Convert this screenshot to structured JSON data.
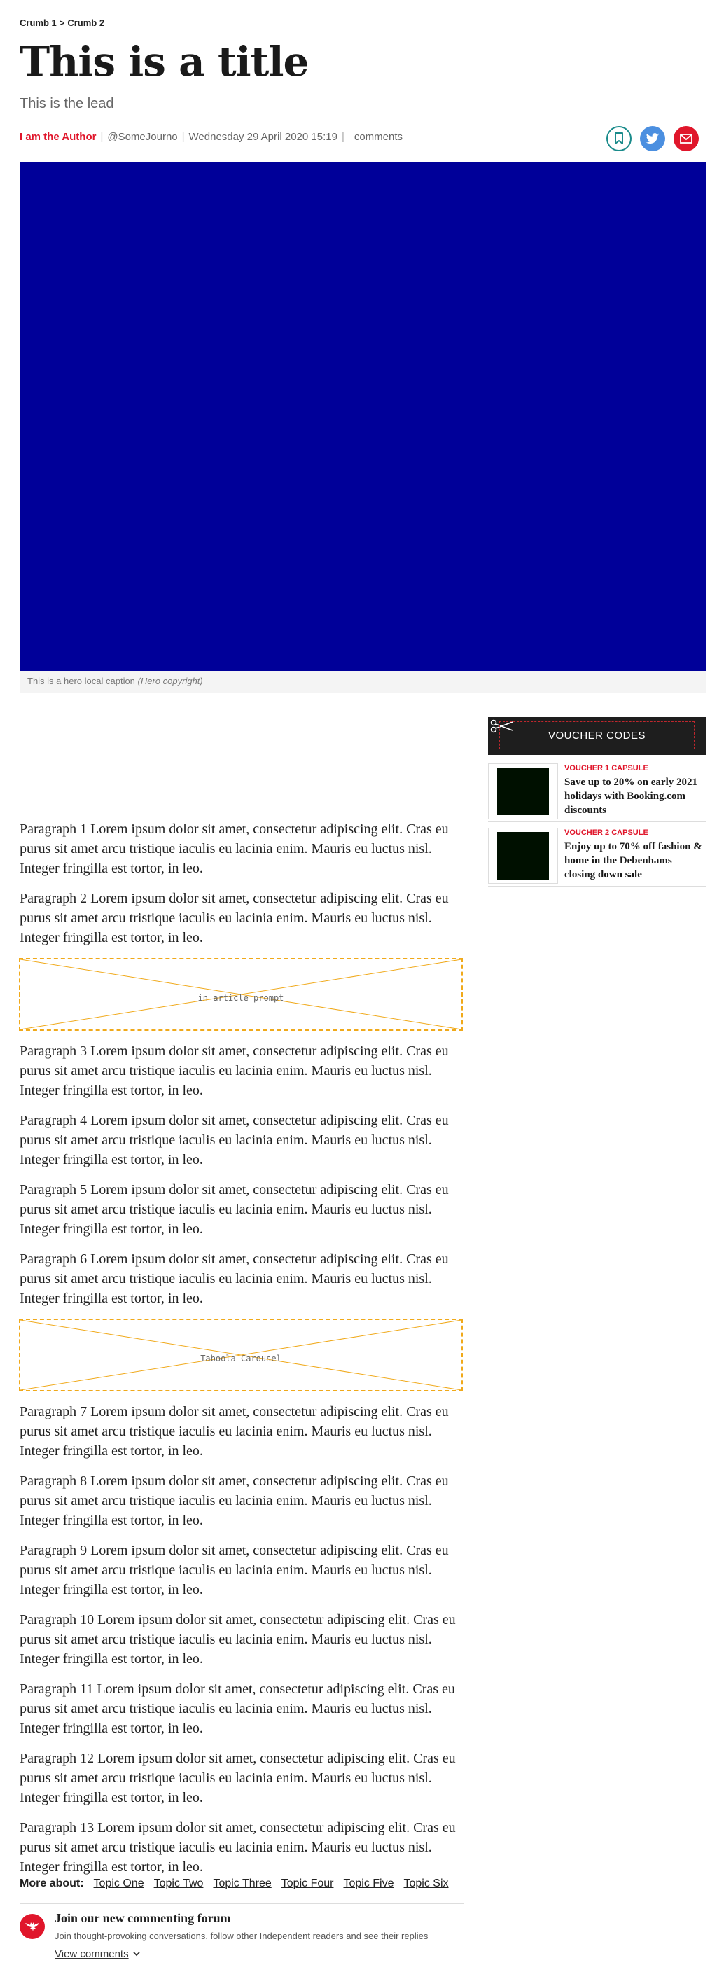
{
  "breadcrumb": {
    "crumb1": "Crumb 1",
    "separator": ">",
    "crumb2": "Crumb 2"
  },
  "title": "This is a title",
  "lead": "This is the lead",
  "byline": {
    "author": "I am the Author",
    "handle": "@SomeJourno",
    "date": "Wednesday 29 April 2020 15:19",
    "comments": "comments"
  },
  "share": {
    "icons": [
      "bookmark-icon",
      "twitter-icon",
      "email-icon"
    ],
    "colors": {
      "bookmark": "#1a8b8b",
      "twitter": "#4b8fe0",
      "email": "#e0162b"
    }
  },
  "hero": {
    "color": "#000099",
    "caption": "This is a hero local caption",
    "copyright": "(Hero copyright)"
  },
  "article": {
    "paragraphs": [
      "Paragraph 1 Lorem ipsum dolor sit amet, consectetur adipiscing elit. Cras eu purus sit amet arcu tristique iaculis eu lacinia enim. Mauris eu luctus nisl. Integer fringilla est tortor, in leo.",
      "Paragraph 2 Lorem ipsum dolor sit amet, consectetur adipiscing elit. Cras eu purus sit amet arcu tristique iaculis eu lacinia enim. Mauris eu luctus nisl. Integer fringilla est tortor, in leo.",
      "Paragraph 3 Lorem ipsum dolor sit amet, consectetur adipiscing elit. Cras eu purus sit amet arcu tristique iaculis eu lacinia enim. Mauris eu luctus nisl. Integer fringilla est tortor, in leo.",
      "Paragraph 4 Lorem ipsum dolor sit amet, consectetur adipiscing elit. Cras eu purus sit amet arcu tristique iaculis eu lacinia enim. Mauris eu luctus nisl. Integer fringilla est tortor, in leo.",
      "Paragraph 5 Lorem ipsum dolor sit amet, consectetur adipiscing elit. Cras eu purus sit amet arcu tristique iaculis eu lacinia enim. Mauris eu luctus nisl. Integer fringilla est tortor, in leo.",
      "Paragraph 6 Lorem ipsum dolor sit amet, consectetur adipiscing elit. Cras eu purus sit amet arcu tristique iaculis eu lacinia enim. Mauris eu luctus nisl. Integer fringilla est tortor, in leo.",
      "Paragraph 7 Lorem ipsum dolor sit amet, consectetur adipiscing elit. Cras eu purus sit amet arcu tristique iaculis eu lacinia enim. Mauris eu luctus nisl. Integer fringilla est tortor, in leo.",
      "Paragraph 8 Lorem ipsum dolor sit amet, consectetur adipiscing elit. Cras eu purus sit amet arcu tristique iaculis eu lacinia enim. Mauris eu luctus nisl. Integer fringilla est tortor, in leo.",
      "Paragraph 9 Lorem ipsum dolor sit amet, consectetur adipiscing elit. Cras eu purus sit amet arcu tristique iaculis eu lacinia enim. Mauris eu luctus nisl. Integer fringilla est tortor, in leo.",
      "Paragraph 10 Lorem ipsum dolor sit amet, consectetur adipiscing elit. Cras eu purus sit amet arcu tristique iaculis eu lacinia enim. Mauris eu luctus nisl. Integer fringilla est tortor, in leo.",
      "Paragraph 11 Lorem ipsum dolor sit amet, consectetur adipiscing elit. Cras eu purus sit amet arcu tristique iaculis eu lacinia enim. Mauris eu luctus nisl. Integer fringilla est tortor, in leo.",
      "Paragraph 12 Lorem ipsum dolor sit amet, consectetur adipiscing elit. Cras eu purus sit amet arcu tristique iaculis eu lacinia enim. Mauris eu luctus nisl. Integer fringilla est tortor, in leo.",
      "Paragraph 13 Lorem ipsum dolor sit amet, consectetur adipiscing elit. Cras eu purus sit amet arcu tristique iaculis eu lacinia enim. Mauris eu luctus nisl. Integer fringilla est tortor, in leo."
    ],
    "ad1": "in article prompt",
    "ad2": "Taboola Carousel",
    "ad_color": "#f0a91a"
  },
  "more_about": {
    "label": "More about:",
    "topics": [
      "Topic One",
      "Topic Two",
      "Topic Three",
      "Topic Four",
      "Topic Five",
      "Topic Six"
    ]
  },
  "forum": {
    "heading": "Join our new commenting forum",
    "description": "Join thought-provoking conversations, follow other Independent readers and see their replies",
    "view_label": "View comments"
  },
  "sidebar": {
    "voucher_title": "VOUCHER CODES",
    "vouchers": [
      {
        "tag": "VOUCHER 1 CAPSULE",
        "text": "Save up to 20% on early 2021 holidays with Booking.com discounts"
      },
      {
        "tag": "VOUCHER 2 CAPSULE",
        "text": "Enjoy up to 70% off fashion & home in the Debenhams closing down sale"
      }
    ]
  }
}
